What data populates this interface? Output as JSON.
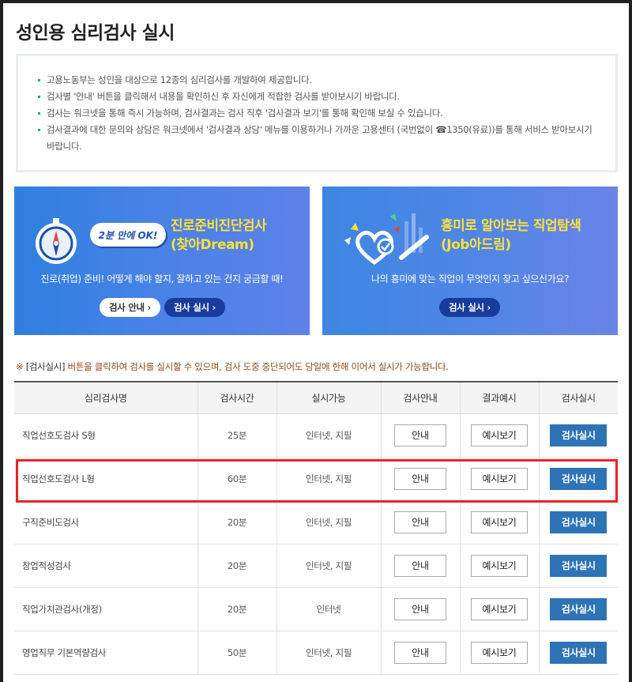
{
  "page": {
    "title": "성인용 심리검사 실시"
  },
  "notice": {
    "items": [
      "고용노동부는 성인을 대상으로 12종의 심리검사를 개발하여 제공합니다.",
      "검사별 '안내' 버튼을 클릭해서 내용을 확인하신 후 자신에게 적합한 검사를 받아보시기 바랍니다.",
      "검사는 워크넷을 통해 즉시 가능하며, 검사결과는 검사 직후 '검사결과 보기'를 통해 확인해 보실 수 있습니다.",
      "검사결과에 대한 문의와 상담은 워크넷에서 '검사결과 상담' 메뉴를 이용하거나 가까운 고용센터 (국번없이 ☎1350(유료))를 통해 서비스 받아보시기 바랍니다."
    ]
  },
  "banners": {
    "left": {
      "badge": "2분 만에 OK!",
      "title_line1": "진로준비진단검사",
      "title_line2": "(찾아Dream)",
      "desc": "진로(취업) 준비! 어떻게 해야 할지, 잘하고 있는 건지 궁금할 때!",
      "guide_button": "검사 안내 ›",
      "run_button": "검사 실시 ›"
    },
    "right": {
      "title_line1": "흥미로 알아보는 직업탐색",
      "title_line2": "(Job아드림)",
      "desc": "나의 흥미에 맞는 직업이 무엇인지 찾고 싶으신가요?",
      "run_button": "검사 실시 ›"
    }
  },
  "hint": {
    "prefix": "※",
    "bracket": "[검사실시]",
    "text": "버튼을 클릭하여 검사를 실시할 수 있으며, 검사 도중 중단되어도 당일에 한해 이어서 실시가 가능합니다."
  },
  "table": {
    "headers": [
      "심리검사명",
      "검사시간",
      "실시가능",
      "검사안내",
      "결과예시",
      "검사실시"
    ],
    "guide_label": "안내",
    "example_label": "예시보기",
    "run_label": "검사실시",
    "rows": [
      {
        "name": "직업선호도검사 S형",
        "time": "25분",
        "mode": "인터넷, 지필"
      },
      {
        "name": "직업선호도검사 L형",
        "time": "60분",
        "mode": "인터넷, 지필"
      },
      {
        "name": "구직준비도검사",
        "time": "20분",
        "mode": "인터넷, 지필"
      },
      {
        "name": "창업적성검사",
        "time": "20분",
        "mode": "인터넷, 지필"
      },
      {
        "name": "직업가치관검사(개정)",
        "time": "20분",
        "mode": "인터넷"
      },
      {
        "name": "영업직무 기본역량검사",
        "time": "50분",
        "mode": "인터넷, 지필"
      }
    ]
  },
  "colors": {
    "accent_blue": "#2f73b7",
    "banner_yellow": "#ffe03a",
    "highlight_red": "#e8242c"
  }
}
